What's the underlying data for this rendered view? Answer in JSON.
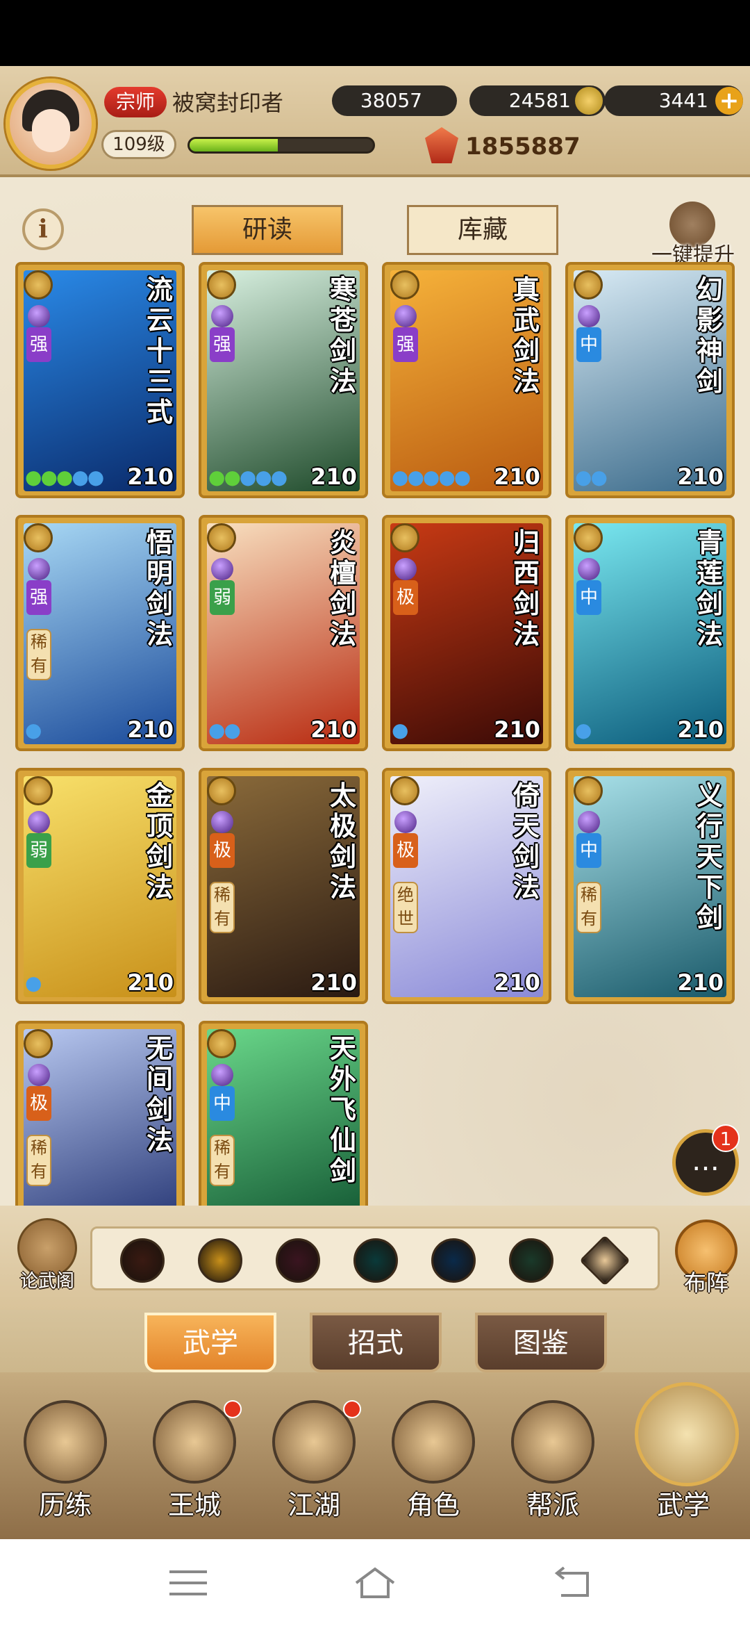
{
  "player": {
    "rank": "宗师",
    "name": "被窝封印者",
    "level": "109级",
    "exp_fraction": 0.48,
    "power": "1855887"
  },
  "resources": [
    {
      "name": "coin",
      "value": "38057"
    },
    {
      "name": "ember",
      "value": "24581"
    },
    {
      "name": "ingot",
      "value": "3441"
    }
  ],
  "tabs": {
    "study": "研读",
    "storage": "库藏",
    "upgrade": "一键提升"
  },
  "cards": [
    {
      "title": "流云十三式",
      "grade": "强",
      "grade_color": "#8a3ec8",
      "level": "210",
      "drops": "gggbb",
      "colors": [
        "#0a2a6a",
        "#2a8ae8"
      ]
    },
    {
      "title": "寒苍剑法",
      "grade": "强",
      "grade_color": "#8a3ec8",
      "level": "210",
      "drops": "ggbbb",
      "colors": [
        "#1e4a2a",
        "#d8f0e0"
      ]
    },
    {
      "title": "真武剑法",
      "grade": "强",
      "grade_color": "#8a3ec8",
      "level": "210",
      "drops": "bbbbb",
      "colors": [
        "#b85a10",
        "#f6b23a"
      ]
    },
    {
      "title": "幻影神剑",
      "grade": "中",
      "grade_color": "#2a8ae0",
      "level": "210",
      "drops": "bb",
      "colors": [
        "#3a6a8a",
        "#d8eaf4"
      ]
    },
    {
      "title": "悟明剑法",
      "grade": "强",
      "grade_color": "#8a3ec8",
      "level": "210",
      "drops": "b",
      "rare": "稀有",
      "colors": [
        "#1a4a9a",
        "#a8d8f4"
      ]
    },
    {
      "title": "炎檀剑法",
      "grade": "弱",
      "grade_color": "#3aa04a",
      "level": "210",
      "drops": "bb",
      "colors": [
        "#b82a10",
        "#f8e0c0"
      ]
    },
    {
      "title": "归西剑法",
      "grade": "极",
      "grade_color": "#d8601a",
      "level": "210",
      "drops": "b",
      "colors": [
        "#3a0a06",
        "#c83a14"
      ]
    },
    {
      "title": "青莲剑法",
      "grade": "中",
      "grade_color": "#2a8ae0",
      "level": "210",
      "drops": "b",
      "colors": [
        "#0a5a7a",
        "#7ae8f0"
      ]
    },
    {
      "title": "金顶剑法",
      "grade": "弱",
      "grade_color": "#3aa04a",
      "level": "210",
      "drops": "b",
      "colors": [
        "#c8901a",
        "#f8e06a"
      ]
    },
    {
      "title": "太极剑法",
      "grade": "极",
      "grade_color": "#d8601a",
      "level": "210",
      "drops": "",
      "rare": "稀有",
      "colors": [
        "#2a1a12",
        "#8a6a3a"
      ]
    },
    {
      "title": "倚天剑法",
      "grade": "极",
      "grade_color": "#d8601a",
      "level": "210",
      "drops": "",
      "rare": "绝世",
      "colors": [
        "#8a8ad8",
        "#f0f0fa"
      ]
    },
    {
      "title": "义行天下剑",
      "grade": "中",
      "grade_color": "#2a8ae0",
      "level": "210",
      "drops": "",
      "rare": "稀有",
      "colors": [
        "#1a5a6a",
        "#a8e0e8"
      ]
    },
    {
      "title": "无间剑法",
      "grade": "极",
      "grade_color": "#d8601a",
      "level": "",
      "drops": "",
      "rare": "稀有",
      "colors": [
        "#1a2a6a",
        "#b8c8f0"
      ]
    },
    {
      "title": "天外飞仙剑",
      "grade": "中",
      "grade_color": "#2a8ae0",
      "level": "",
      "drops": "",
      "rare": "稀有",
      "colors": [
        "#0a4a2a",
        "#6ad88a"
      ]
    }
  ],
  "chat": {
    "badge": "1"
  },
  "filter": {
    "left_label": "论武阁",
    "right_label": "布阵",
    "icons": [
      "sword-icon",
      "gold-sword-icon",
      "fist-icon",
      "palm-icon",
      "yin-yang-icon",
      "swirl-icon",
      "arrow-up-icon"
    ]
  },
  "subtabs": [
    "武学",
    "招式",
    "图鉴"
  ],
  "nav": [
    "历练",
    "王城",
    "江湖",
    "角色",
    "帮派",
    "武学"
  ]
}
